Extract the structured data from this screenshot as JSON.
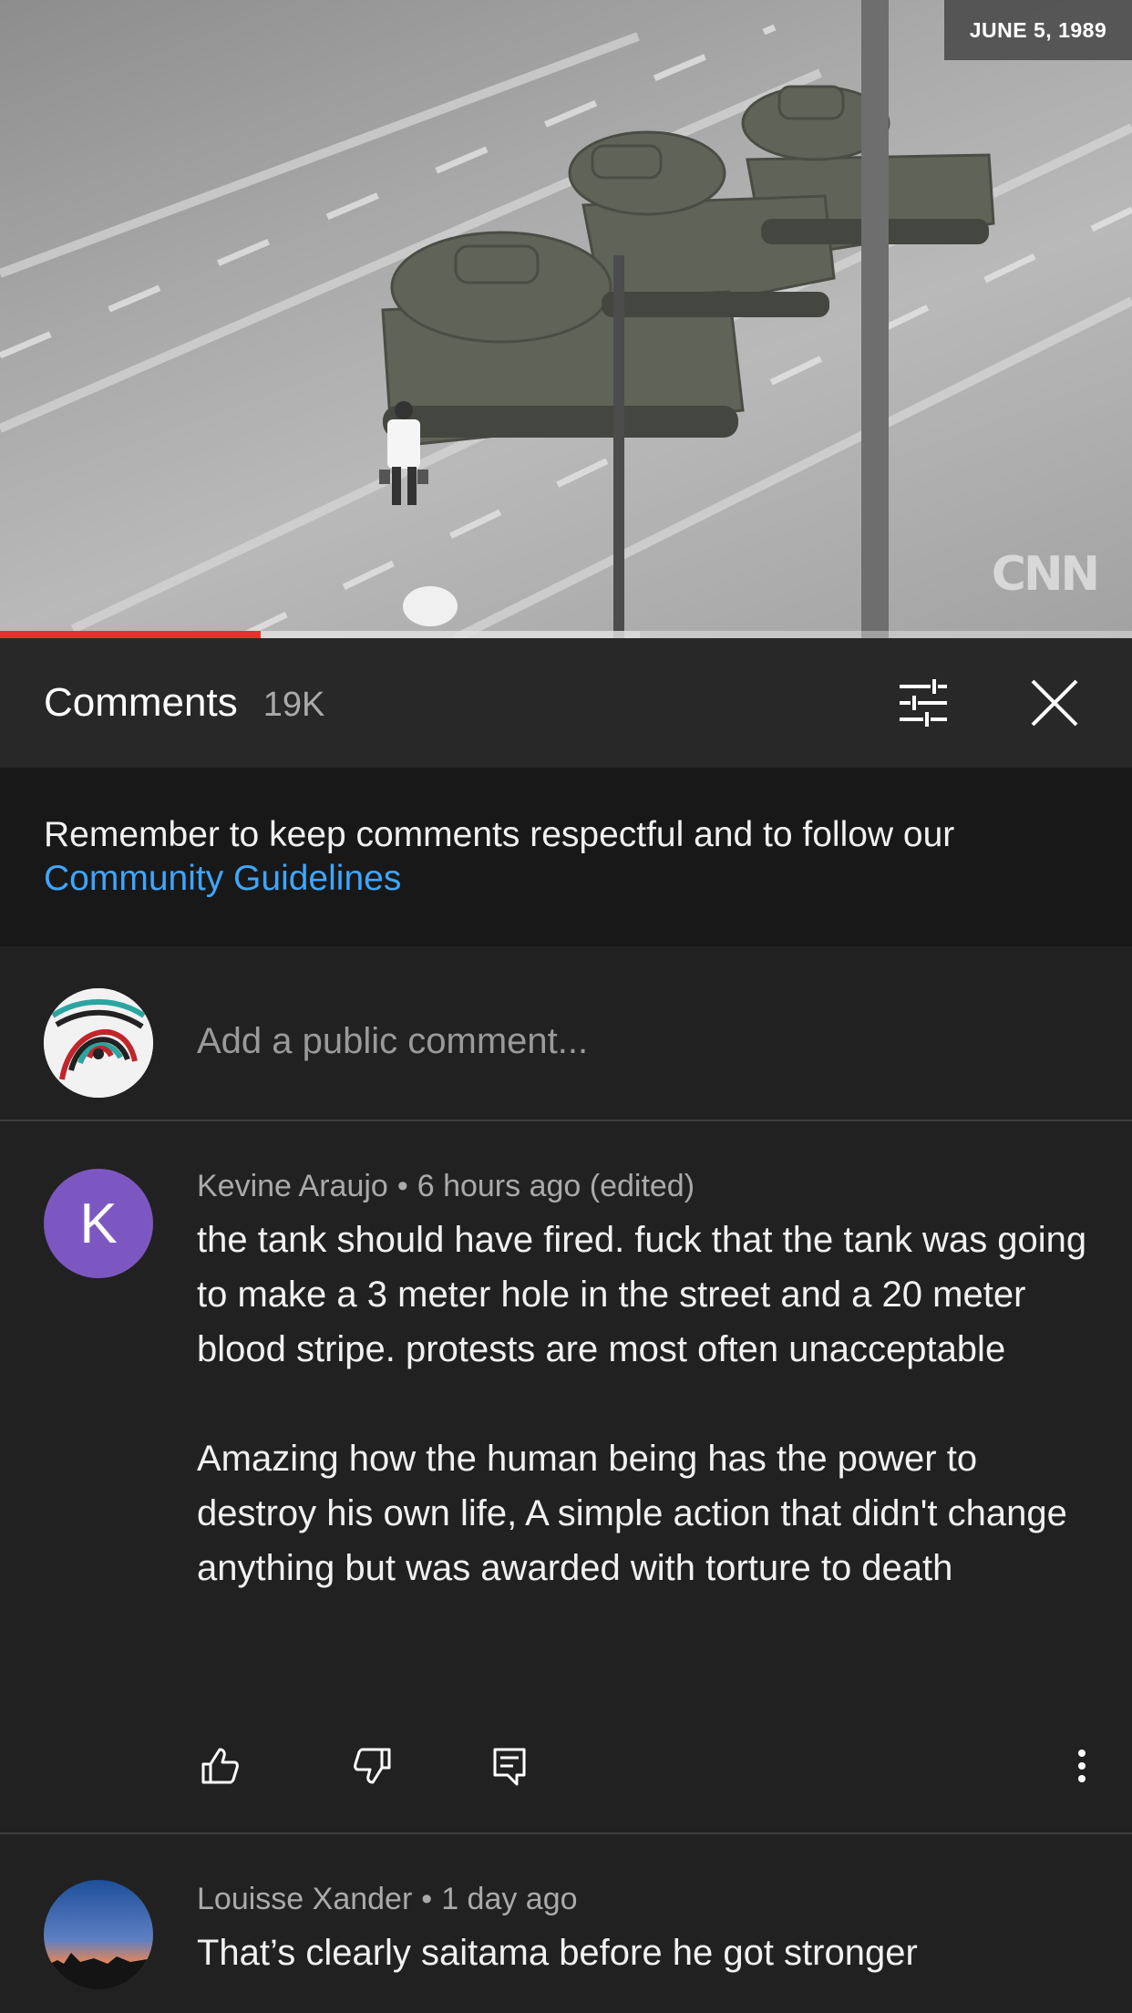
{
  "video": {
    "date_overlay": "JUNE 5, 1989",
    "watermark": "CNN",
    "progress": {
      "played_fraction": 0.23,
      "buffered_fraction": 0.565
    },
    "progress_color": "#e8312c"
  },
  "comments_panel": {
    "title": "Comments",
    "count": "19K",
    "icons": {
      "sort": "sort-filter-icon",
      "close": "close-icon"
    }
  },
  "guidelines": {
    "text": "Remember to keep comments respectful and to follow our",
    "link": "Community Guidelines",
    "link_color": "#3ea6ff"
  },
  "add_comment": {
    "placeholder": "Add a public comment..."
  },
  "comments": [
    {
      "avatar_letter": "K",
      "avatar_color": "#7d57c1",
      "author": "Kevine Araujo",
      "time": "6 hours ago (edited)",
      "paragraphs": [
        "the tank should have fired. fuck that the tank was going to make a 3 meter hole in the street and a 20 meter blood stripe. protests are most often unacceptable",
        "Amazing how the human being has the power to destroy his own life, A simple action that didn't change anything but was awarded with torture to death"
      ],
      "actions": [
        "like-icon",
        "dislike-icon",
        "reply-icon",
        "more-icon"
      ]
    },
    {
      "author": "Louisse Xander",
      "time": "1 day ago",
      "paragraphs": [
        "That’s clearly saitama before he got stronger"
      ]
    }
  ]
}
